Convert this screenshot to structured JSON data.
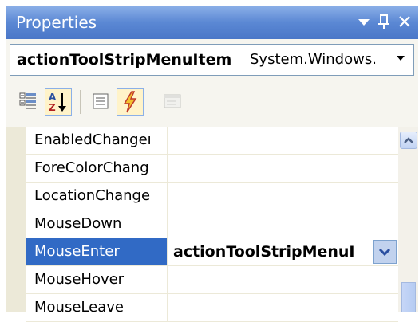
{
  "window": {
    "title": "Properties",
    "buttons": {
      "dropdown_icon": "dropdown-arrow-icon",
      "pin_label": "❠",
      "close_label": "X"
    }
  },
  "object_selector": {
    "name": "actionToolStripMenuItem",
    "type": "System.Windows.",
    "arrow_icon": "chevron-down-icon"
  },
  "toolbar": {
    "buttons": [
      {
        "icon": "categorized-icon",
        "checked": false
      },
      {
        "icon": "alphabetical-icon",
        "checked": true
      },
      {
        "icon": "properties-icon",
        "checked": false
      },
      {
        "icon": "events-lightning-icon",
        "checked": true
      },
      {
        "icon": "property-pages-icon",
        "checked": false,
        "disabled": true
      }
    ]
  },
  "grid": {
    "rows": [
      {
        "name": "EnabledChangeı",
        "value": ""
      },
      {
        "name": "ForeColorChang",
        "value": ""
      },
      {
        "name": "LocationChange",
        "value": ""
      },
      {
        "name": "MouseDown",
        "value": ""
      },
      {
        "name": "MouseEnter",
        "value": "actionToolStripMenuI",
        "selected": true
      },
      {
        "name": "MouseHover",
        "value": ""
      },
      {
        "name": "MouseLeave",
        "value": ""
      }
    ]
  },
  "colors": {
    "titlebar": "#5b88d4",
    "selection": "#316ac5",
    "gutter": "#ece9d8"
  }
}
